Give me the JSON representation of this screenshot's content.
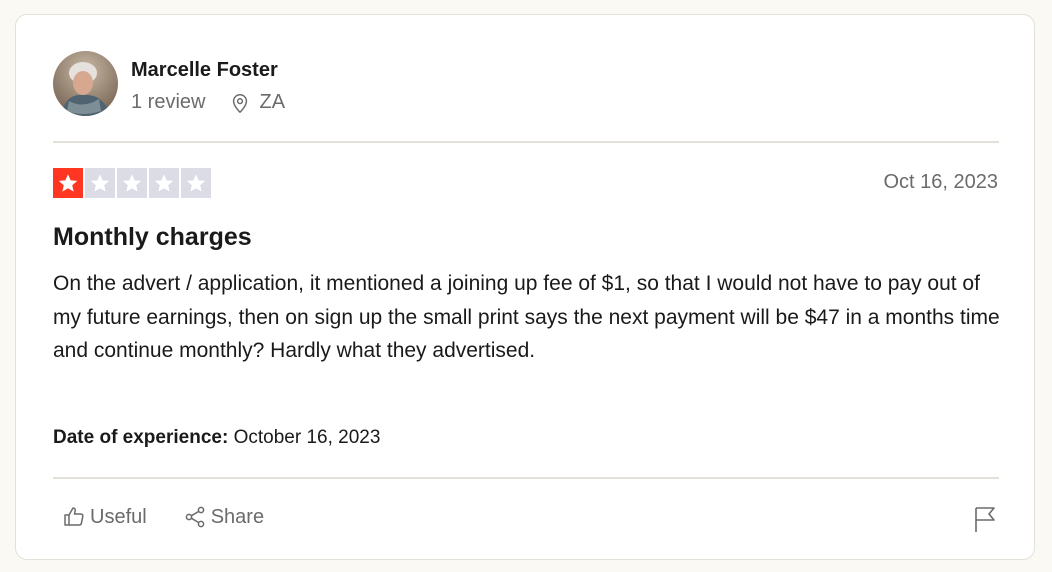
{
  "reviewer": {
    "name": "Marcelle Foster",
    "review_count": "1 review",
    "country": "ZA"
  },
  "review": {
    "rating": 1,
    "max_rating": 5,
    "date": "Oct 16, 2023",
    "title": "Monthly charges",
    "body": "On the advert / application, it mentioned a joining up fee of $1, so that I would not have to pay out of my future earnings, then on sign up the small print says the next payment will be $47 in a months time and continue monthly? Hardly what they advertised.",
    "experience_label": "Date of experience:",
    "experience_date": "October 16, 2023"
  },
  "actions": {
    "useful_label": "Useful",
    "share_label": "Share"
  },
  "colors": {
    "star_active": "#ff3722",
    "star_inactive": "#dcdce6",
    "muted_text": "#6b6b6b"
  },
  "icons": [
    "location-pin-icon",
    "star-icon",
    "thumbs-up-icon",
    "share-icon",
    "flag-icon"
  ]
}
